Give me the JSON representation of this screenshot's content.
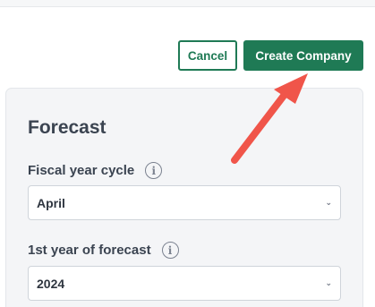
{
  "actions": {
    "cancel_label": "Cancel",
    "create_label": "Create Company"
  },
  "form": {
    "section_title": "Forecast",
    "fields": [
      {
        "label": "Fiscal year cycle",
        "value": "April",
        "info_icon": "i"
      },
      {
        "label": "1st year of forecast",
        "value": "2024",
        "info_icon": "i"
      }
    ]
  },
  "icons": {
    "info": "info-icon",
    "dropdown": "chevron-down-icon",
    "annotation": "red-arrow"
  },
  "colors": {
    "brand": "#1f7a55",
    "annotation": "#f0554a"
  }
}
